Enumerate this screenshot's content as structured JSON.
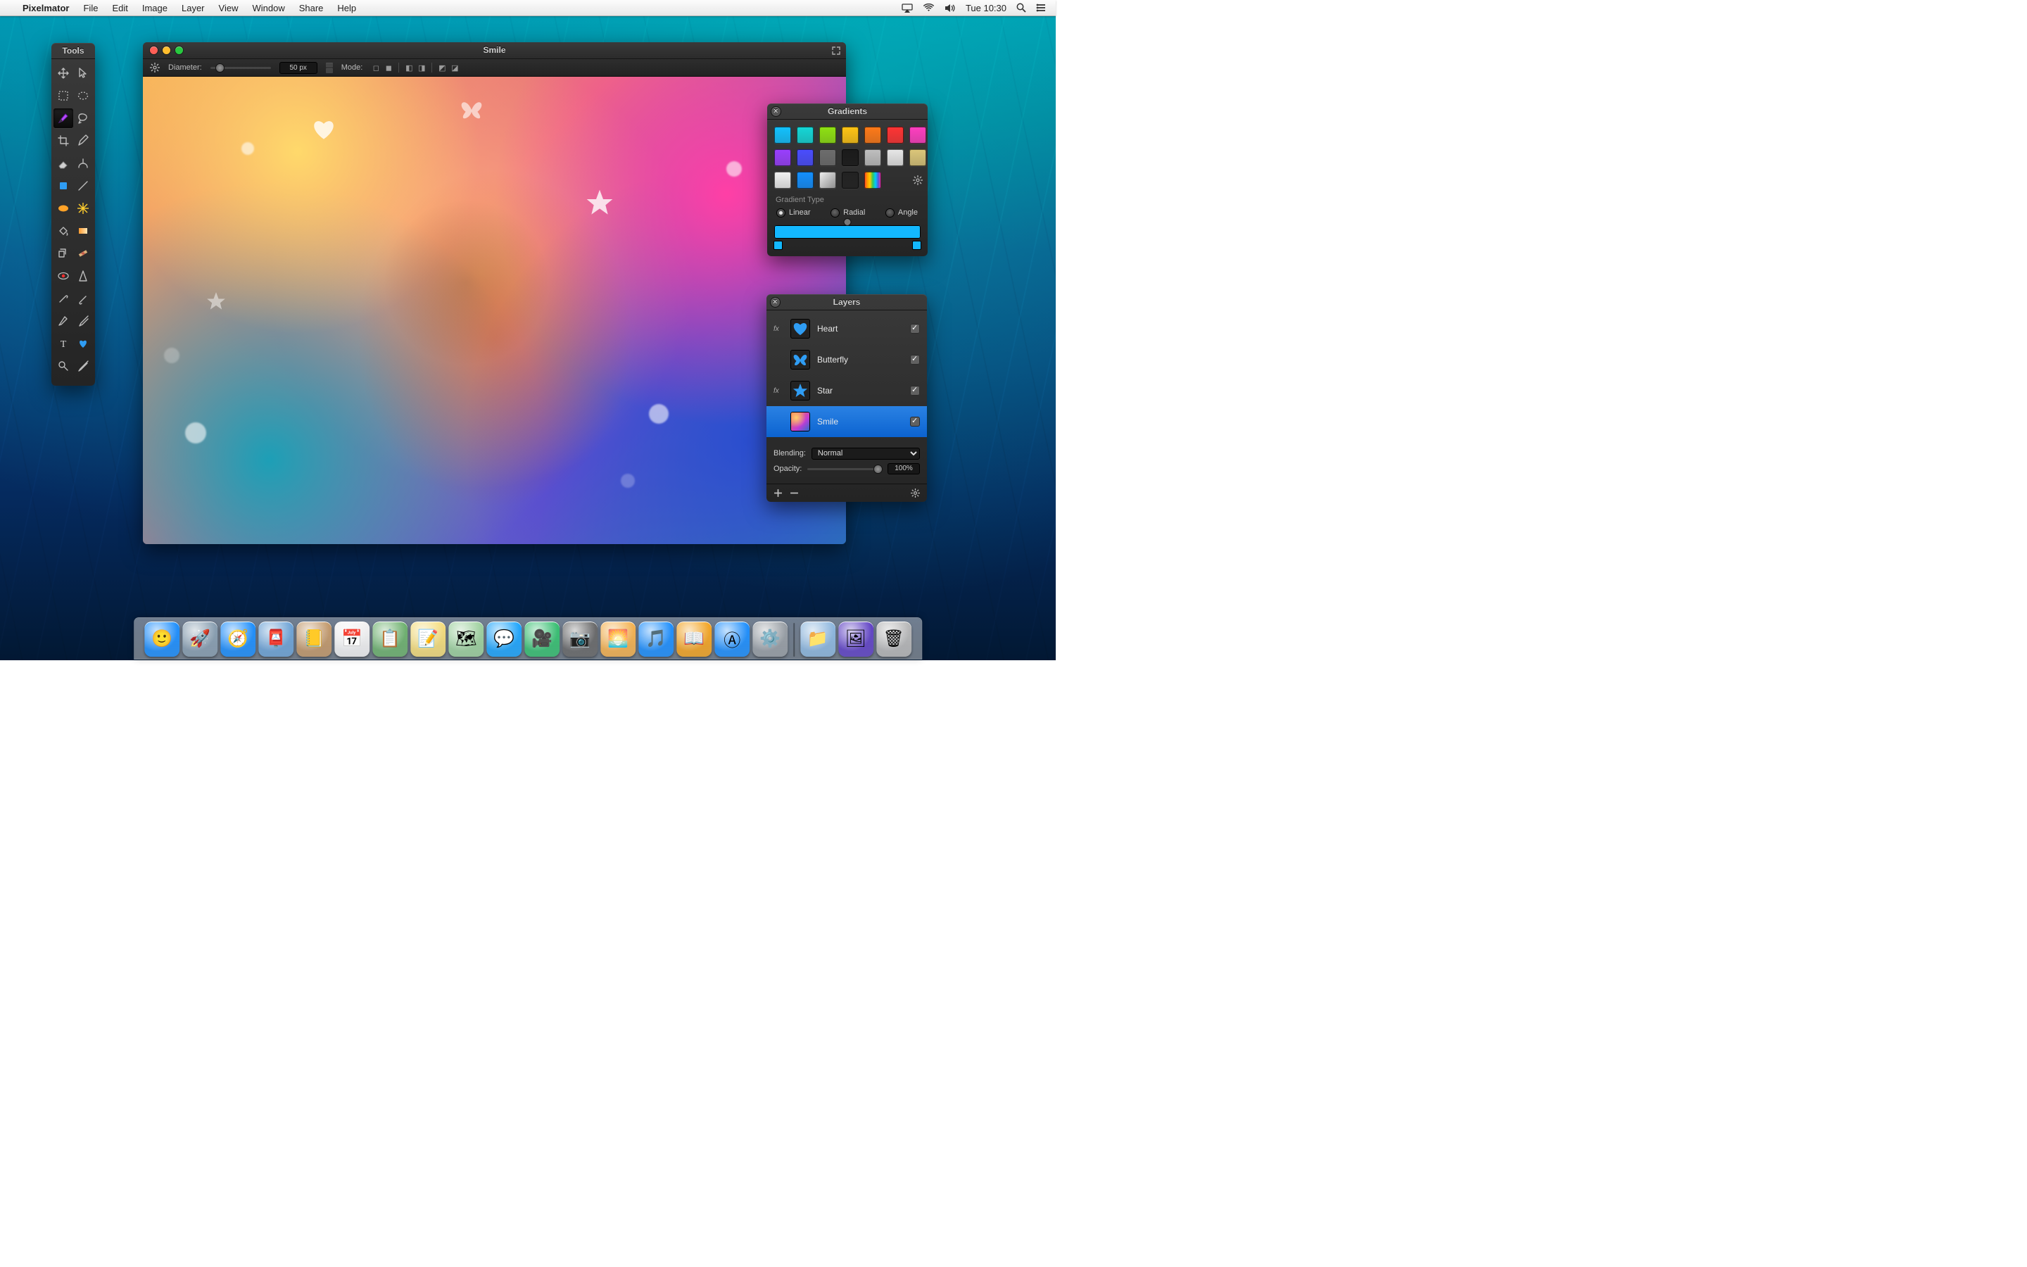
{
  "menubar": {
    "app_name": "Pixelmator",
    "items": [
      "File",
      "Edit",
      "Image",
      "Layer",
      "View",
      "Window",
      "Share",
      "Help"
    ],
    "clock": "Tue 10:30"
  },
  "tools_panel": {
    "title": "Tools",
    "tools": [
      "move",
      "pointer",
      "rect-select",
      "oval-select",
      "brush",
      "lasso",
      "crop",
      "pencil",
      "eraser",
      "paint",
      "shape",
      "line",
      "blur",
      "sparkle",
      "bucket",
      "gradient",
      "clone",
      "heal",
      "red-eye",
      "sharpen",
      "dodge",
      "burn",
      "pen",
      "eyedropper",
      "text",
      "heart",
      "zoom",
      "color-picker"
    ],
    "selected": "brush"
  },
  "document": {
    "title": "Smile",
    "toolbar": {
      "diameter_label": "Diameter:",
      "diameter_value": "50 px",
      "mode_label": "Mode:"
    }
  },
  "gradients_panel": {
    "title": "Gradients",
    "section_label": "Gradient Type",
    "types": {
      "linear": "Linear",
      "radial": "Radial",
      "angle": "Angle"
    },
    "selected_type": "linear",
    "swatches": [
      "#12c2ff",
      "#14d7d7",
      "#8fe212",
      "#ffc414",
      "#ff7a18",
      "#ff3434",
      "#ff3fc1",
      "#9a3fff",
      "#4a4dff",
      "#6d6d6d",
      "#1a1a1a",
      "#bfbfbf",
      "#e8e8e8",
      "#dcc77a",
      "#f2f2f2",
      "#1390ff",
      "metal",
      "#222222",
      "rainbow"
    ],
    "preview_stops": [
      "#13b8ff",
      "#13b8ff"
    ]
  },
  "layers_panel": {
    "title": "Layers",
    "blending_label": "Blending:",
    "blending_value": "Normal",
    "opacity_label": "Opacity:",
    "opacity_value": "100%",
    "layers": [
      {
        "name": "Heart",
        "fx": true,
        "icon": "heart",
        "checked": true
      },
      {
        "name": "Butterfly",
        "fx": false,
        "icon": "butterfly",
        "checked": true
      },
      {
        "name": "Star",
        "fx": true,
        "icon": "star",
        "checked": true
      },
      {
        "name": "Smile",
        "fx": false,
        "icon": "photo",
        "checked": true,
        "selected": true
      }
    ]
  },
  "dock": {
    "apps": [
      "finder",
      "launchpad",
      "safari",
      "mail",
      "contacts",
      "calendar",
      "reminders",
      "notes",
      "maps",
      "messages",
      "facetime",
      "photo-booth",
      "iphoto",
      "itunes",
      "ibooks",
      "app-store",
      "preferences"
    ],
    "right_apps": [
      "documents",
      "pixelmator",
      "trash"
    ]
  }
}
